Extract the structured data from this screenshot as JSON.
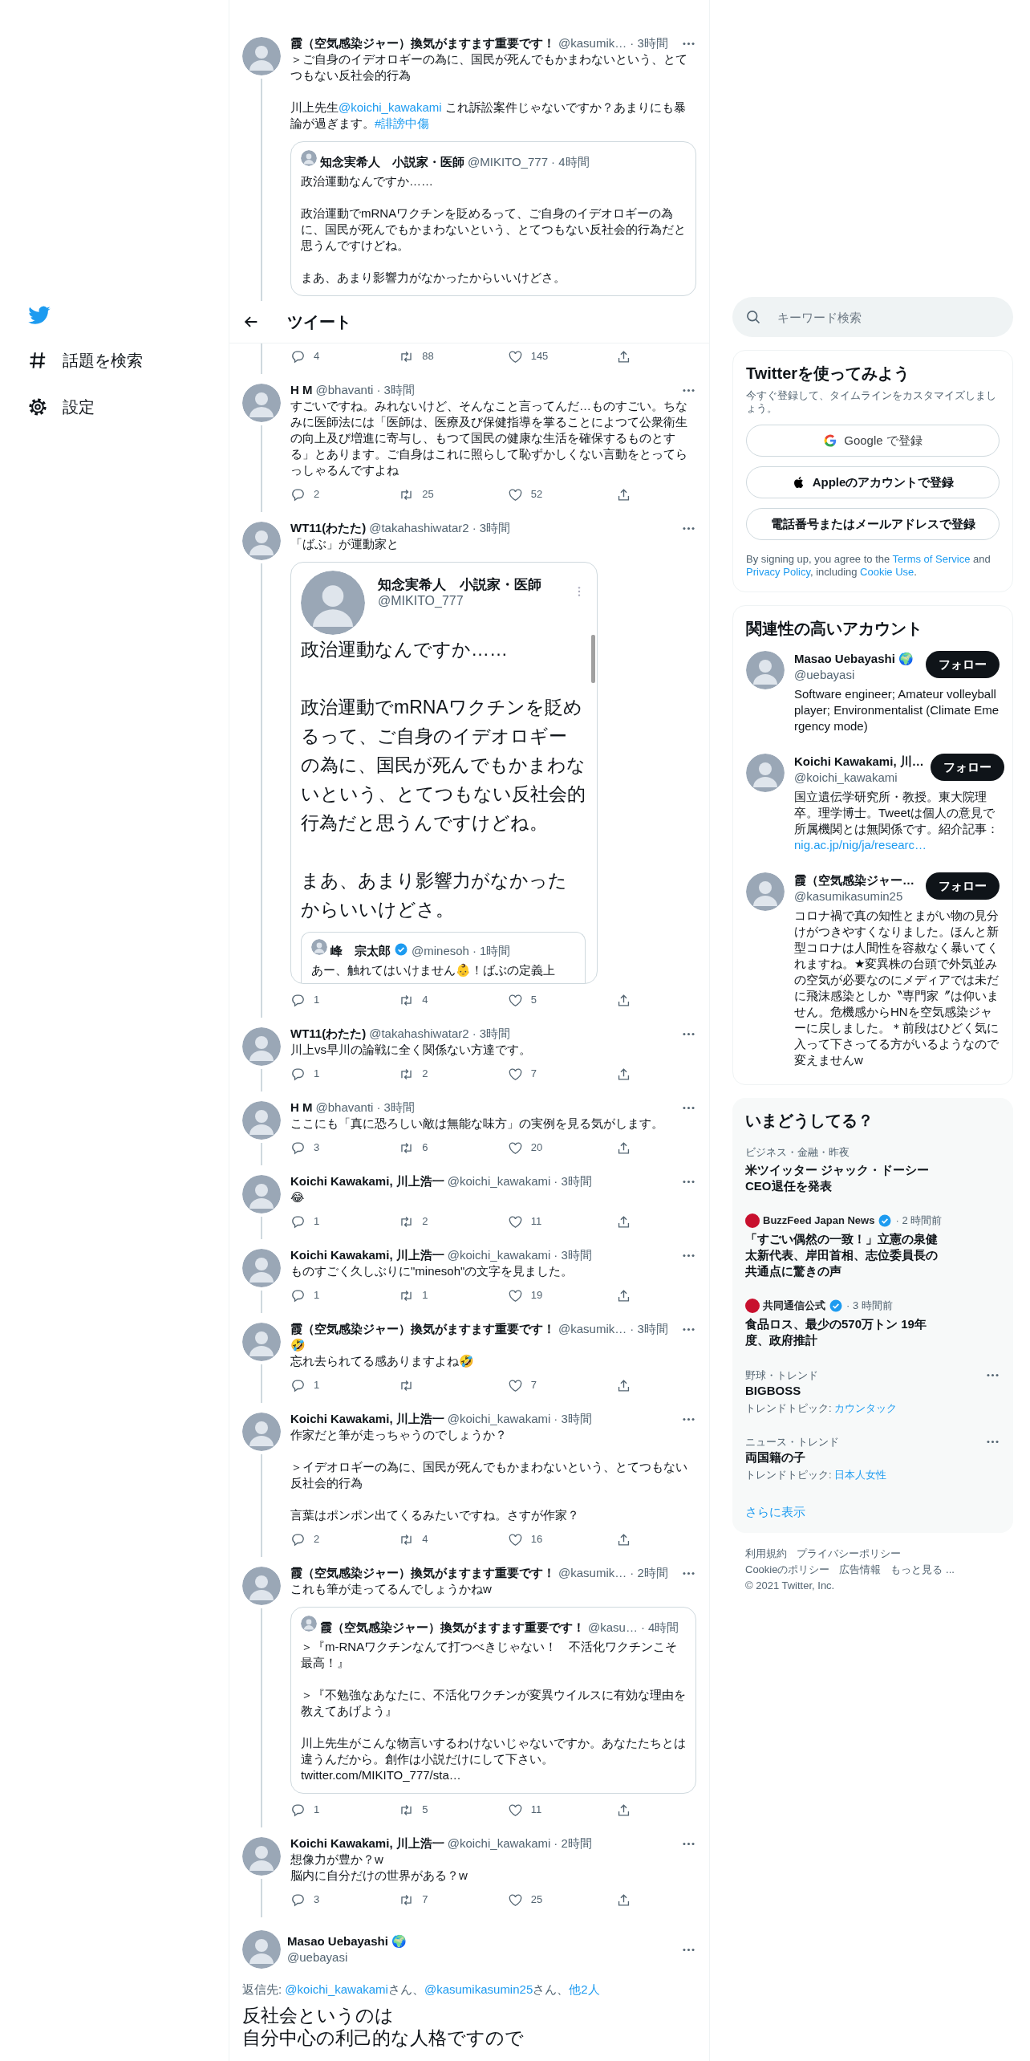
{
  "nav": {
    "items": [
      {
        "label": "話題を検索",
        "kind": "explore"
      },
      {
        "label": "設定",
        "kind": "settings"
      }
    ]
  },
  "header": {
    "title": "ツイート"
  },
  "tweets": [
    {
      "name": "霞（空気感染ジャー）換気がますます重要です！",
      "handle": "@kasumik…",
      "time": "· 3時間",
      "body": [
        "＞ご自身のイデオロギーの為に、国民が死んでもかまわないという、とてつもない反社会的行為",
        [
          {
            "text": "川上先生",
            "link": false
          },
          {
            "text": "@koichi_kawakami",
            "link": true
          },
          {
            "text": " これ訴訟案件じゃないですか？あまりにも暴論が過ぎます。",
            "link": false
          },
          {
            "text": "#誹謗中傷",
            "link": true
          }
        ]
      ],
      "quote": {
        "kind": "compact",
        "name": "知念実希人　小説家・医師",
        "handle": "@MIKITO_777",
        "time": "· 4時間",
        "body": [
          "政治運動なんですか……",
          "政治運動でmRNAワクチンを貶めるって、ご自身のイデオロギーの為に、国民が死んでもかまわないという、とてつもない反社会的行為だと思うんですけどね。",
          "まあ、あまり影響力がなかったからいいけどさ。"
        ]
      },
      "stats": {
        "replies": "4",
        "retweets": "88",
        "likes": "145"
      }
    },
    {
      "name": "H M",
      "handle": "@bhavanti",
      "time": "· 3時間",
      "body": [
        "すごいですね。みれないけど、そんなこと言ってんだ…ものすごい。ちなみに医師法には「医師は、医療及び保健指導を掌ることによつて公衆衛生の向上及び増進に寄与し、もつて国民の健康な生活を確保するものとする」とあります。ご自身はこれに照らして恥ずかしくない言動をとってらっしゃるんですよね"
      ],
      "stats": {
        "replies": "2",
        "retweets": "25",
        "likes": "52"
      }
    },
    {
      "name": "WT11(わたた)",
      "handle": "@takahashiwatar2",
      "time": "· 3時間",
      "body": [
        "「ばぶ」が運動家と"
      ],
      "quote": {
        "kind": "large",
        "name": "知念実希人　小説家・医師",
        "handle": "@MIKITO_777",
        "body": [
          "政治運動なんですか……",
          "政治運動でmRNAワクチンを貶めるって、ご自身のイデオロギーの為に、国民が死んでもかまわないという、とてつもない反社会的行為だと思うんですけどね。",
          "まあ、あまり影響力がなかったからいいけどさ。"
        ],
        "quote": {
          "kind": "compact",
          "name": "峰　宗太郎",
          "verified": true,
          "handle": "@minesoh",
          "time": "· 1時間",
          "body": [
            "あー、触れてはいけません👶！ばぶの定義上"
          ]
        }
      },
      "stats": {
        "replies": "1",
        "retweets": "4",
        "likes": "5"
      }
    },
    {
      "name": "WT11(わたた)",
      "handle": "@takahashiwatar2",
      "time": "· 3時間",
      "body": [
        "川上vs早川の論戦に全く関係ない方達です。"
      ],
      "stats": {
        "replies": "1",
        "retweets": "2",
        "likes": "7"
      }
    },
    {
      "name": "H M",
      "handle": "@bhavanti",
      "time": "· 3時間",
      "body": [
        "ここにも「真に恐ろしい敵は無能な味方」の実例を見る気がします。"
      ],
      "stats": {
        "replies": "3",
        "retweets": "6",
        "likes": "20"
      }
    },
    {
      "name": "Koichi Kawakami, 川上浩一",
      "handle": "@koichi_kawakami",
      "time": "· 3時間",
      "body": [
        "😂"
      ],
      "stats": {
        "replies": "1",
        "retweets": "2",
        "likes": "11"
      }
    },
    {
      "name": "Koichi Kawakami, 川上浩一",
      "handle": "@koichi_kawakami",
      "time": "· 3時間",
      "body": [
        "ものすごく久しぶりに\"minesoh\"の文字を見ました。"
      ],
      "stats": {
        "replies": "1",
        "retweets": "1",
        "likes": "19"
      }
    },
    {
      "name": "霞（空気感染ジャー）換気がますます重要です！",
      "handle": "@kasumik…",
      "time": "· 3時間",
      "body": [
        "🤣\n忘れ去られてる感ありますよね🤣"
      ],
      "stats": {
        "replies": "1",
        "likes": "7"
      }
    },
    {
      "name": "Koichi Kawakami, 川上浩一",
      "handle": "@koichi_kawakami",
      "time": "· 3時間",
      "body": [
        "作家だと筆が走っちゃうのでしょうか？",
        "＞イデオロギーの為に、国民が死んでもかまわないという、とてつもない反社会的行為",
        "言葉はポンポン出てくるみたいですね。さすが作家？"
      ],
      "stats": {
        "replies": "2",
        "retweets": "4",
        "likes": "16"
      }
    },
    {
      "name": "霞（空気感染ジャー）換気がますます重要です！",
      "handle": "@kasumik…",
      "time": "· 2時間",
      "body": [
        "これも筆が走ってるんでしょうかねw"
      ],
      "quote": {
        "kind": "compact",
        "name": "霞（空気感染ジャー）換気がますます重要です！",
        "handle": "@kasu…",
        "time": "· 4時間",
        "body": [
          "＞『m-RNAワクチンなんて打つべきじゃない！　不活化ワクチンこそ最高！』",
          "＞『不勉強なあなたに、不活化ワクチンが変異ウイルスに有効な理由を教えてあげよう』",
          "川上先生がこんな物言いするわけないじゃないですか。あなたたちとは違うんだから。創作は小説だけにして下さい。\ntwitter.com/MIKITO_777/sta…"
        ]
      },
      "stats": {
        "replies": "1",
        "retweets": "5",
        "likes": "11"
      }
    },
    {
      "name": "Koichi Kawakami, 川上浩一",
      "handle": "@koichi_kawakami",
      "time": "· 2時間",
      "body": [
        "想像力が豊か？w\n脳内に自分だけの世界がある？w"
      ],
      "stats": {
        "replies": "3",
        "retweets": "7",
        "likes": "25"
      }
    }
  ],
  "main_tweet": {
    "name": "Masao Uebayashi 🌍",
    "handle": "@uebayasi",
    "reply_to": [
      {
        "text": "返信先: ",
        "link": false
      },
      {
        "text": "@koichi_kawakami",
        "link": true
      },
      {
        "text": "さん、",
        "link": false
      },
      {
        "text": "@kasumikasumin25",
        "link": true
      },
      {
        "text": "さん、",
        "link": false
      },
      {
        "text": "他2人",
        "link": true
      }
    ],
    "body": [
      "反社会というのは",
      "自分中心の利己的な人格ですので"
    ]
  },
  "search": {
    "placeholder": "キーワード検索"
  },
  "signup": {
    "title": "Twitterを使ってみよう",
    "subtitle": "今すぐ登録して、タイムラインをカスタマイズしましょう。",
    "buttons": [
      {
        "label": "Google で登録",
        "kind": "google"
      },
      {
        "label": "Appleのアカウントで登録",
        "kind": "apple"
      },
      {
        "label": "電話番号またはメールアドレスで登録",
        "kind": "plain"
      }
    ],
    "legal": [
      {
        "text": "By signing up, you agree to the ",
        "link": false
      },
      {
        "text": "Terms of Service",
        "link": true
      },
      {
        "text": " and ",
        "link": false
      },
      {
        "text": "Privacy Policy",
        "link": true
      },
      {
        "text": ", including ",
        "link": false
      },
      {
        "text": "Cookie Use",
        "link": true
      },
      {
        "text": ".",
        "link": false
      }
    ]
  },
  "who_to_follow": {
    "title": "関連性の高いアカウント",
    "accounts": [
      {
        "name": "Masao Uebayashi 🌍",
        "handle": "@uebayasi",
        "bio": [
          {
            "text": "Software engineer; Amateur volleyball player; Environmentalist (Climate Emergency mode)",
            "link": false
          }
        ],
        "button": "フォロー"
      },
      {
        "name": "Koichi Kawakami, 川…",
        "handle": "@koichi_kawakami",
        "bio": [
          {
            "text": "国立遺伝学研究所・教授。東大院理卒。理学博士。Tweetは個人の意見で所属機関とは無関係です。紹介記事：",
            "link": false
          },
          {
            "text": "nig.ac.jp/nig/ja/researc…",
            "link": true
          }
        ],
        "button": "フォロー"
      },
      {
        "name": "霞（空気感染ジャー…",
        "handle": "@kasumikasumin25",
        "bio": [
          {
            "text": "コロナ禍で真の知性とまがい物の見分けがつきやすくなりました。ほんと新型コロナは人間性を容赦なく暴いてくれますね。★変異株の台頭で外気並みの空気が必要なのにメディアでは未だに飛沫感染としか〝専門家〞は仰いません。危機感からHNを空気感染ジャーに戻しました。＊前段はひどく気に入って下さってる方がいるようなので変えませんw",
            "link": false
          }
        ],
        "button": "フォロー"
      }
    ]
  },
  "trends": {
    "title": "いまどうしてる？",
    "items": [
      {
        "kind": "topic",
        "context": "ビジネス・金融・昨夜",
        "title": "米ツイッター ジャック・ドーシーCEO退任を発表"
      },
      {
        "kind": "news",
        "source": "BuzzFeed Japan News",
        "verified": true,
        "time": "· 2 時間前",
        "title": "「すごい偶然の一致！」立憲の泉健太新代表、岸田首相、志位委員長の共通点に驚きの声"
      },
      {
        "kind": "news",
        "source": "共同通信公式",
        "verified": true,
        "time": "· 3 時間前",
        "title": "食品ロス、最少の570万トン 19年度、政府推計"
      },
      {
        "kind": "trend",
        "context": "野球・トレンド",
        "title": "BIGBOSS",
        "related_label": "トレンドトピック: ",
        "related": "カウンタック"
      },
      {
        "kind": "trend",
        "context": "ニュース・トレンド",
        "title": "両国籍の子",
        "related_label": "トレンドトピック: ",
        "related": "日本人女性"
      }
    ],
    "more": "さらに表示"
  },
  "footer": {
    "lines": [
      [
        "利用規約",
        "プライバシーポリシー"
      ],
      [
        "Cookieのポリシー",
        "広告情報",
        "もっと見る ..."
      ]
    ],
    "copyright": "© 2021 Twitter, Inc."
  }
}
